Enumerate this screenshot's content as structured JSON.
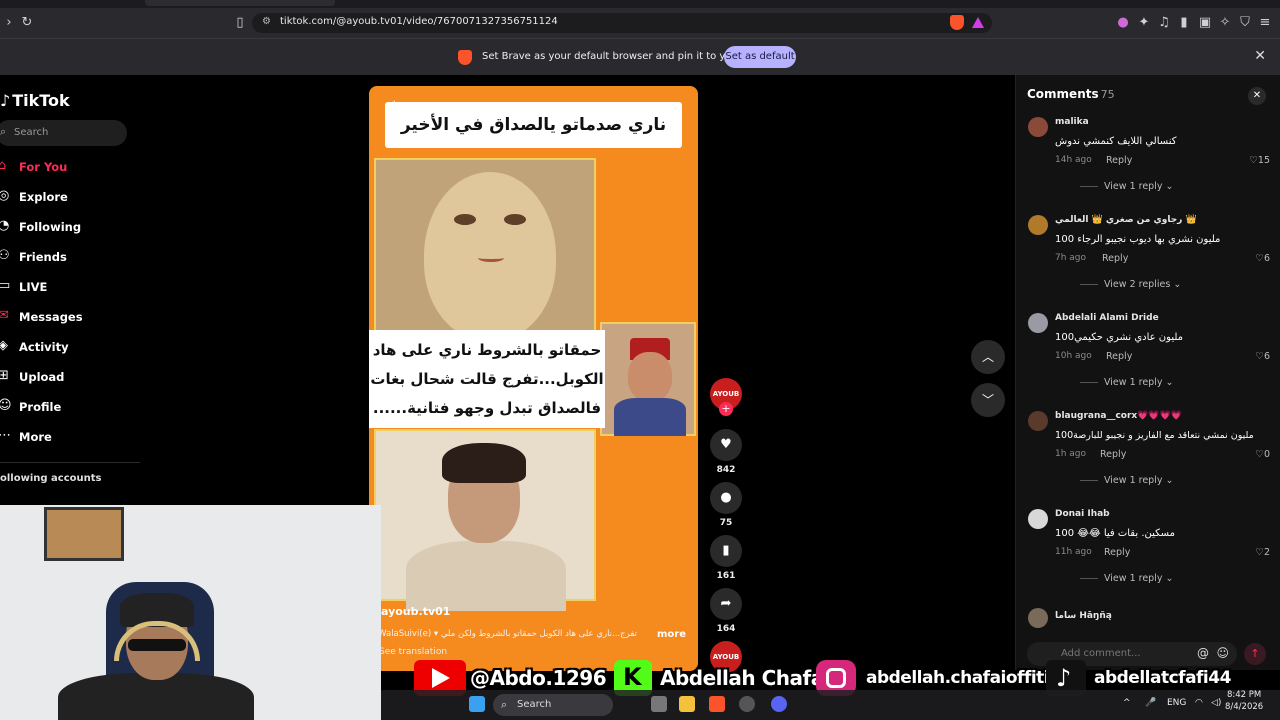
{
  "browser": {
    "url": "tiktok.com/@ayoub.tv01/video/7670071327356751124",
    "infobar_message": "Set Brave as your default browser and pin it to your taskbar",
    "infobar_button": "Set as default"
  },
  "sidebar": {
    "logo": "TikTok",
    "search_placeholder": "Search",
    "items": [
      {
        "label": "For You",
        "icon": "home-icon"
      },
      {
        "label": "Explore",
        "icon": "compass-icon"
      },
      {
        "label": "Following",
        "icon": "following-icon"
      },
      {
        "label": "Friends",
        "icon": "friends-icon"
      },
      {
        "label": "LIVE",
        "icon": "live-icon"
      },
      {
        "label": "Messages",
        "icon": "messages-icon"
      },
      {
        "label": "Activity",
        "icon": "activity-icon"
      },
      {
        "label": "Upload",
        "icon": "upload-icon"
      },
      {
        "label": "Profile",
        "icon": "profile-icon"
      },
      {
        "label": "More",
        "icon": "more-icon"
      }
    ],
    "following_title": "ollowing accounts"
  },
  "video": {
    "title": "ناري صدماتو يالصداق في الأخير",
    "caption": "حمقاتو بالشروط ناري على هاد الكوبل...تفرج قالت شحال بغات فالصداق تبدل وجهو فتانية......",
    "author": "ayoub.tv01",
    "description": "تفرج...ناري على هاد الكوبل حمقاتو بالشروط ولكن ملي ▾ WalaSuivi(e)",
    "more": "more",
    "see_translation": "See translation"
  },
  "actions": {
    "avatar_text": "AYOUB",
    "likes": "842",
    "comments": "75",
    "saves": "161",
    "shares": "164"
  },
  "comments": {
    "title": "Comments",
    "count": "75",
    "items": [
      {
        "user": "malika",
        "text": "كنسالي اللايف كنمشي ندوش",
        "time": "14h ago",
        "reply": "Reply",
        "likes": "15",
        "view": "View 1 reply",
        "avatar": "#8a4a3a"
      },
      {
        "user": "رجاوي من صغري 👑 العالمي 👑",
        "text": "مليون نشري بها ديوب نجيبو الرجاء 100",
        "time": "7h ago",
        "reply": "Reply",
        "likes": "6",
        "view": "View 2 replies",
        "avatar": "#b07a2a"
      },
      {
        "user": "Abdelali Alami Dride",
        "text": "مليون عادي نشري حكيمي100",
        "time": "10h ago",
        "reply": "Reply",
        "likes": "6",
        "view": "View 1 reply",
        "avatar": "#9a9aa5"
      },
      {
        "user": "blaugrana__corx💗💗💗💗",
        "text": "مليون نمشي نتعاقد مع الفاريز و نجيبو للبارصة100",
        "time": "1h ago",
        "reply": "Reply",
        "likes": "0",
        "view": "View 1 reply",
        "avatar": "#5a3a2a"
      },
      {
        "user": "Donai Ihab",
        "text": "مسكين. بقات فيا 😂😂 100",
        "time": "11h ago",
        "reply": "Reply",
        "likes": "2",
        "view": "View 1 reply",
        "avatar": "#d8d8d8"
      },
      {
        "user": "ﺳﺎﻣﺎ Hāŋñą",
        "text": "",
        "time": "",
        "reply": "",
        "likes": "",
        "view": "",
        "avatar": "#7a6a5a"
      }
    ],
    "add_placeholder": "Add comment..."
  },
  "social": {
    "youtube": "@Abdo.1296",
    "kick": "Abdellah Chafai",
    "instagram": "abdellah.chafaioffitid",
    "tiktok": "abdellatcfafi44"
  },
  "taskbar": {
    "search": "Search",
    "lang": "ENG",
    "time": "8:42 PM",
    "date": "8/4/2026"
  }
}
